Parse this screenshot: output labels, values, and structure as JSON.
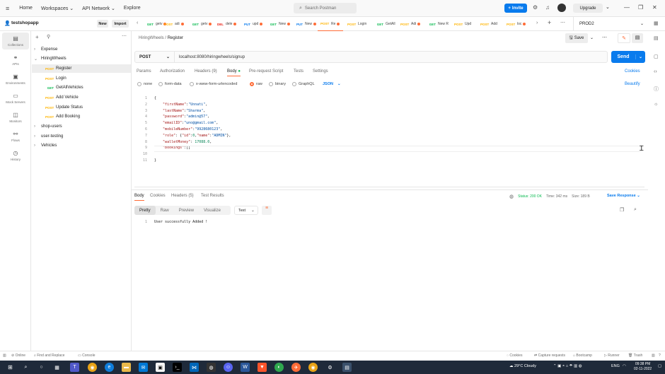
{
  "topbar": {
    "nav": [
      "Home",
      "Workspaces",
      "API Network",
      "Explore"
    ],
    "search_placeholder": "Search Postman",
    "invite": "Invite",
    "upgrade": "Upgrade"
  },
  "sidebar": {
    "workspace": "testshopapp",
    "new_btn": "New",
    "import_btn": "Import",
    "rail": [
      "Collections",
      "APIs",
      "Environments",
      "Mock Servers",
      "Monitors",
      "Flows",
      "History"
    ],
    "collections": [
      {
        "name": "Expense"
      },
      {
        "name": "HiringWheels",
        "expanded": true,
        "children": [
          {
            "method": "POST",
            "name": "Register"
          },
          {
            "method": "POST",
            "name": "Login"
          },
          {
            "method": "GET",
            "name": "GetAllVehicles"
          },
          {
            "method": "POST",
            "name": "Add Vehicle"
          },
          {
            "method": "POST",
            "name": "Update Status"
          },
          {
            "method": "POST",
            "name": "Add Booking"
          }
        ]
      },
      {
        "name": "shop-users"
      },
      {
        "name": "user-testing"
      },
      {
        "name": "Vehicles"
      }
    ]
  },
  "tabs": [
    {
      "method": "GET",
      "label": "getv"
    },
    {
      "method": "POST",
      "label": "adi"
    },
    {
      "method": "GET",
      "label": "getv"
    },
    {
      "method": "DEL",
      "label": "dele"
    },
    {
      "method": "PUT",
      "label": "upd"
    },
    {
      "method": "GET",
      "label": "New"
    },
    {
      "method": "PUT",
      "label": "New"
    },
    {
      "method": "POST",
      "label": "Re"
    },
    {
      "method": "POST",
      "label": "Login"
    },
    {
      "method": "GET",
      "label": "GetAll"
    },
    {
      "method": "POST",
      "label": "Adi"
    },
    {
      "method": "GET",
      "label": "New R"
    },
    {
      "method": "POST",
      "label": "Upd"
    },
    {
      "method": "POST",
      "label": "Add"
    },
    {
      "method": "POST",
      "label": "loc"
    }
  ],
  "environment": "PROD2",
  "request": {
    "breadcrumb_parent": "HiringWheels",
    "breadcrumb_current": "Register",
    "save": "Save",
    "method": "POST",
    "url": "localhost:8080/hiringwheels/signup",
    "send": "Send",
    "tabs": [
      "Params",
      "Authorization",
      "Headers (9)",
      "Body",
      "Pre-request Script",
      "Tests",
      "Settings"
    ],
    "cookies": "Cookies",
    "body_types": [
      "none",
      "form-data",
      "x-www-form-urlencoded",
      "raw",
      "binary",
      "GraphQL"
    ],
    "format": "JSON",
    "beautify": "Beautify",
    "body_lines": [
      "{",
      "    \"firstName\":\"Unnati\",",
      "    \"lastName\":\"Sharma\",",
      "    \"password\":\"admin@57\",",
      "    \"emailID\":\"uno@gmail.com\",",
      "    \"mobileNumber\":\"9928680123\",",
      "    \"role\": {\"id\":0,\"name\":\"ADMIN\"},",
      "    \"walletMoney\": 17088.0,",
      "    \"bookings\":[]",
      "",
      "}"
    ]
  },
  "response": {
    "tabs": [
      "Body",
      "Cookies",
      "Headers (5)",
      "Test Results"
    ],
    "status": "Status: 200 OK",
    "time": "Time: 342 ms",
    "size": "Size: 189 B",
    "save_response": "Save Response",
    "views": [
      "Pretty",
      "Raw",
      "Preview",
      "Visualize"
    ],
    "format": "Text",
    "line": "User successfully Added !"
  },
  "statusbar": {
    "left": [
      "Online",
      "Find and Replace",
      "Console"
    ],
    "right": [
      "Cookies",
      "Capture requests",
      "Bootcamp",
      "Runner",
      "Trash"
    ]
  },
  "taskbar": {
    "weather": "29°C  Cloudy",
    "lang": "ENG",
    "time": "09:38 PM",
    "date": "02-11-2022"
  }
}
